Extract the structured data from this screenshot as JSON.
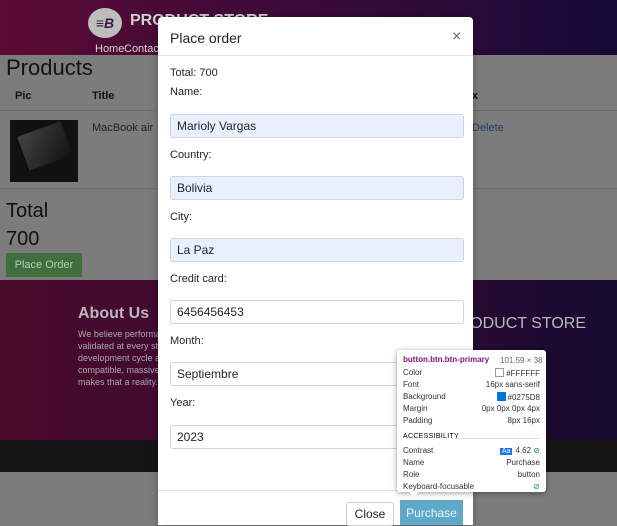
{
  "navbar": {
    "brand": "PRODUCT STORE",
    "logo_text": "≡B",
    "links": [
      "Home",
      "Contact"
    ]
  },
  "page": {
    "heading": "Products",
    "columns": [
      "Pic",
      "Title",
      "x"
    ],
    "rows": [
      {
        "title": "MacBook air",
        "action": "Delete"
      }
    ],
    "total_label": "Total",
    "total_value": "700",
    "place_order": "Place Order"
  },
  "footer": {
    "about_title": "About Us",
    "about_lines": [
      "We believe performa",
      "validated at every st",
      "development cycle a",
      "compatible, massive",
      "makes that a reality."
    ],
    "store_title": "PRODUCT STORE"
  },
  "modal": {
    "title": "Place order",
    "close_symbol": "×",
    "total_text": "Total: 700",
    "fields": [
      {
        "label": "Name:",
        "value": "Marioly Vargas"
      },
      {
        "label": "Country:",
        "value": "Bolivia"
      },
      {
        "label": "City:",
        "value": "La Paz"
      },
      {
        "label": "Credit card:",
        "value": "6456456453"
      },
      {
        "label": "Month:",
        "value": "Septiembre"
      },
      {
        "label": "Year:",
        "value": "2023"
      }
    ],
    "close_button": "Close",
    "purchase_button": "Purchase"
  },
  "devtools_tooltip": {
    "selector": "button.btn.btn-primary",
    "dimensions": "101.59 × 38",
    "props": [
      {
        "key": "Color",
        "value": "#FFFFFF"
      },
      {
        "key": "Font",
        "value": "16px sans-serif"
      },
      {
        "key": "Background",
        "value": "#0275D8"
      },
      {
        "key": "Margin",
        "value": "0px 0px 0px 4px"
      },
      {
        "key": "Padding",
        "value": "8px 16px"
      }
    ],
    "accessibility_title": "ACCESSIBILITY",
    "contrast_label": "Contrast",
    "contrast_badge": "Aa",
    "contrast_value": "4.62",
    "name_label": "Name",
    "name_value": "Purchase",
    "role_label": "Role",
    "role_value": "button",
    "focus_label": "Keyboard-focusable",
    "check_symbol": "⊘"
  },
  "colors": {
    "autofill": "#e8f0fe",
    "primary": "#0275D8",
    "swatch_color": "#FFFFFF"
  }
}
